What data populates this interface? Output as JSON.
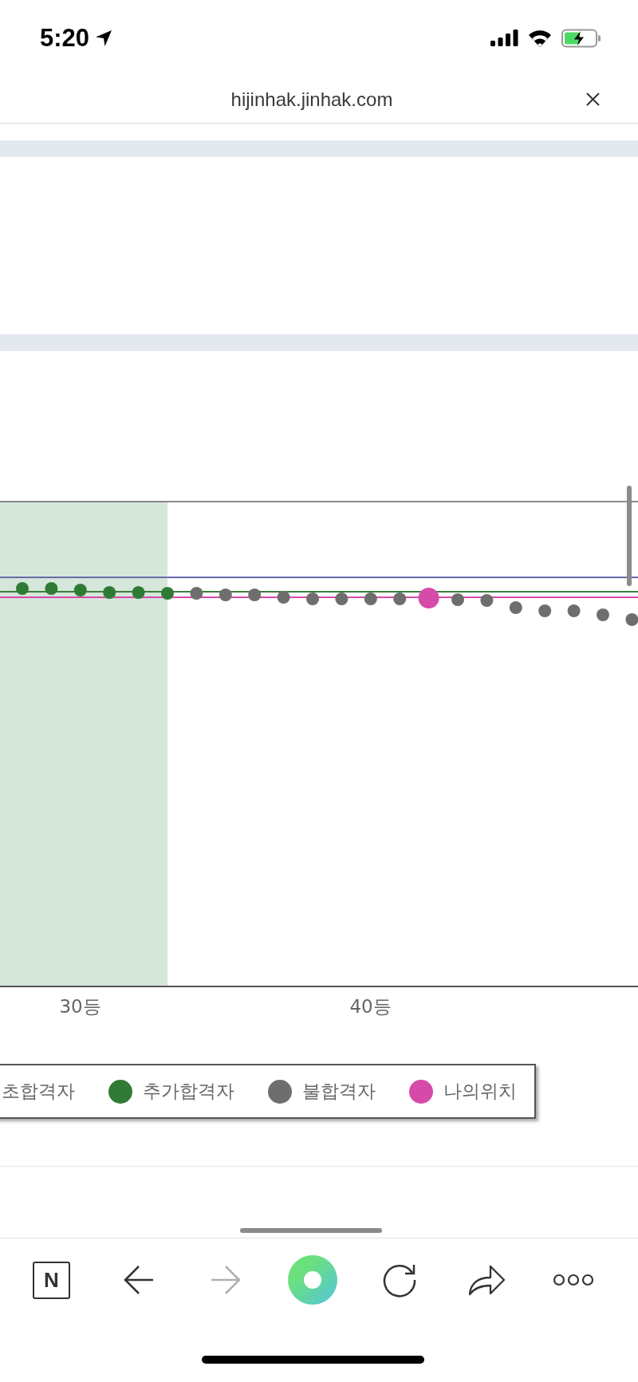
{
  "status_bar": {
    "time": "5:20"
  },
  "browser_bar": {
    "url": "hijinhak.jinhak.com"
  },
  "chart": {
    "x_ticks": [
      "30등",
      "40등"
    ],
    "legend": [
      {
        "label": "초합격자"
      },
      {
        "label": "추가합격자",
        "color": "#2f7b36"
      },
      {
        "label": "불합격자",
        "color": "#6e6e6e"
      },
      {
        "label": "나의위치",
        "color": "#d64aa9"
      }
    ]
  },
  "toolbar": [
    {
      "kind": "logo",
      "label": "N",
      "disabled": false
    },
    {
      "kind": "back",
      "disabled": false
    },
    {
      "kind": "forward",
      "disabled": true
    },
    {
      "kind": "ring",
      "disabled": false
    },
    {
      "kind": "reload",
      "disabled": false
    },
    {
      "kind": "share",
      "disabled": false
    },
    {
      "kind": "more",
      "disabled": false
    }
  ]
}
